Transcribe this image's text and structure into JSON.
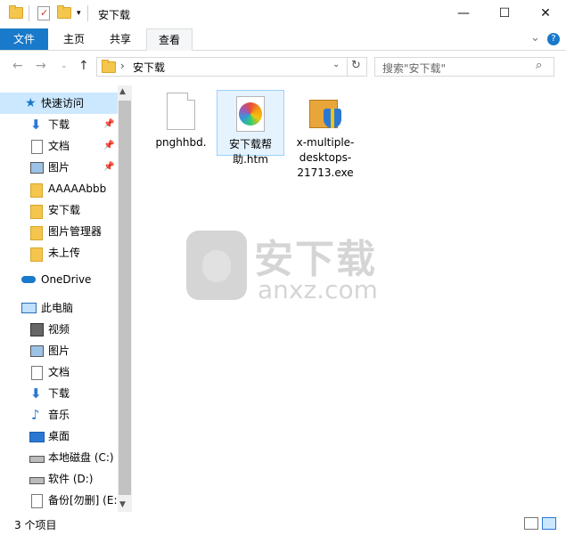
{
  "window": {
    "title": "安下载",
    "minimize": "—",
    "maximize": "☐",
    "close": "✕"
  },
  "ribbon": {
    "tabs": [
      "文件",
      "主页",
      "共享",
      "查看"
    ],
    "collapse_glyph": "⌄",
    "help_glyph": "?"
  },
  "address": {
    "path": "安下载",
    "separator": "›"
  },
  "search": {
    "placeholder": "搜索\"安下载\""
  },
  "nav": {
    "quick_access": "快速访问",
    "quick_items": [
      {
        "label": "下载",
        "icon": "download-icon",
        "pinned": true
      },
      {
        "label": "文档",
        "icon": "document-icon",
        "pinned": true
      },
      {
        "label": "图片",
        "icon": "pictures-icon",
        "pinned": true
      },
      {
        "label": "AAAAAbbb",
        "icon": "folder-icon",
        "pinned": false
      },
      {
        "label": "安下载",
        "icon": "folder-icon",
        "pinned": false
      },
      {
        "label": "图片管理器",
        "icon": "folder-icon",
        "pinned": false
      },
      {
        "label": "未上传",
        "icon": "folder-icon",
        "pinned": false
      }
    ],
    "onedrive": "OneDrive",
    "this_pc": "此电脑",
    "pc_items": [
      {
        "label": "视频",
        "icon": "video-icon"
      },
      {
        "label": "图片",
        "icon": "pictures-icon"
      },
      {
        "label": "文档",
        "icon": "document-icon"
      },
      {
        "label": "下载",
        "icon": "download-icon"
      },
      {
        "label": "音乐",
        "icon": "music-icon"
      },
      {
        "label": "桌面",
        "icon": "desktop-icon"
      },
      {
        "label": "本地磁盘 (C:)",
        "icon": "drive-icon"
      },
      {
        "label": "软件 (D:)",
        "icon": "drive-icon"
      },
      {
        "label": "备份[勿删] (E:)",
        "icon": "drive-icon"
      }
    ]
  },
  "files": [
    {
      "name": "pnghhbd.",
      "icon": "blank-file-icon"
    },
    {
      "name_line1": "安下载帮",
      "name_line2": "助.htm",
      "icon": "html-file-icon"
    },
    {
      "name_line1": "x-multiple-",
      "name_line2": "desktops-",
      "name_line3": "21713.exe",
      "icon": "installer-icon"
    }
  ],
  "watermark": {
    "text": "安下载",
    "sub": "anxz.com"
  },
  "status": {
    "count": "3 个项目"
  },
  "colors": {
    "accent": "#1979ca",
    "selection": "#cce8ff",
    "folder": "#f4c64e"
  }
}
